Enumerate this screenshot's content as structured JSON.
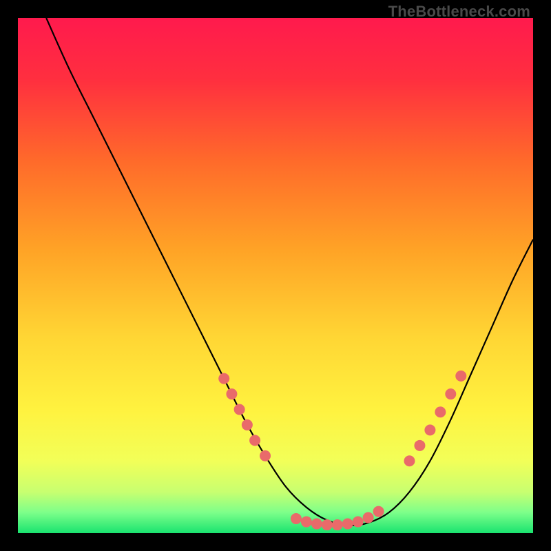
{
  "watermark": "TheBottleneck.com",
  "chart_data": {
    "type": "line",
    "title": "",
    "xlabel": "",
    "ylabel": "",
    "xlim": [
      0,
      100
    ],
    "ylim": [
      0,
      100
    ],
    "grid": false,
    "legend": false,
    "series": [
      {
        "name": "curve",
        "x": [
          5.5,
          10,
          15,
          20,
          25,
          30,
          35,
          40,
          44,
          48,
          52,
          56,
          60,
          64,
          68,
          72,
          76,
          80,
          84,
          88,
          92,
          96,
          100
        ],
        "y": [
          100,
          90,
          80,
          70,
          60,
          50,
          40,
          30,
          22,
          15,
          9,
          5,
          2.5,
          1.5,
          2,
          4,
          8,
          14,
          22,
          31,
          40,
          49,
          57
        ]
      },
      {
        "name": "marker-cluster-left",
        "type": "scatter",
        "x": [
          40,
          41.5,
          43,
          44.5,
          46,
          48
        ],
        "y": [
          30,
          27,
          24,
          21,
          18,
          15
        ]
      },
      {
        "name": "marker-cluster-bottom",
        "type": "scatter",
        "x": [
          54,
          56,
          58,
          60,
          62,
          64,
          66,
          68,
          70
        ],
        "y": [
          2.8,
          2.2,
          1.8,
          1.6,
          1.6,
          1.8,
          2.2,
          3,
          4.2
        ]
      },
      {
        "name": "marker-cluster-right",
        "type": "scatter",
        "x": [
          76,
          78,
          80,
          82,
          84,
          86
        ],
        "y": [
          14,
          17,
          20,
          23.5,
          27,
          30.5
        ]
      }
    ],
    "background_gradient": {
      "stops": [
        {
          "pos": 0.0,
          "color": "#ff1a4d"
        },
        {
          "pos": 0.12,
          "color": "#ff2f3f"
        },
        {
          "pos": 0.28,
          "color": "#ff6b2a"
        },
        {
          "pos": 0.45,
          "color": "#ffa326"
        },
        {
          "pos": 0.62,
          "color": "#ffd634"
        },
        {
          "pos": 0.76,
          "color": "#fff23f"
        },
        {
          "pos": 0.86,
          "color": "#f2ff58"
        },
        {
          "pos": 0.92,
          "color": "#c8ff70"
        },
        {
          "pos": 0.96,
          "color": "#7dff8a"
        },
        {
          "pos": 1.0,
          "color": "#19e36f"
        }
      ]
    },
    "marker_color": "#e96a6a",
    "curve_color": "#000000"
  }
}
